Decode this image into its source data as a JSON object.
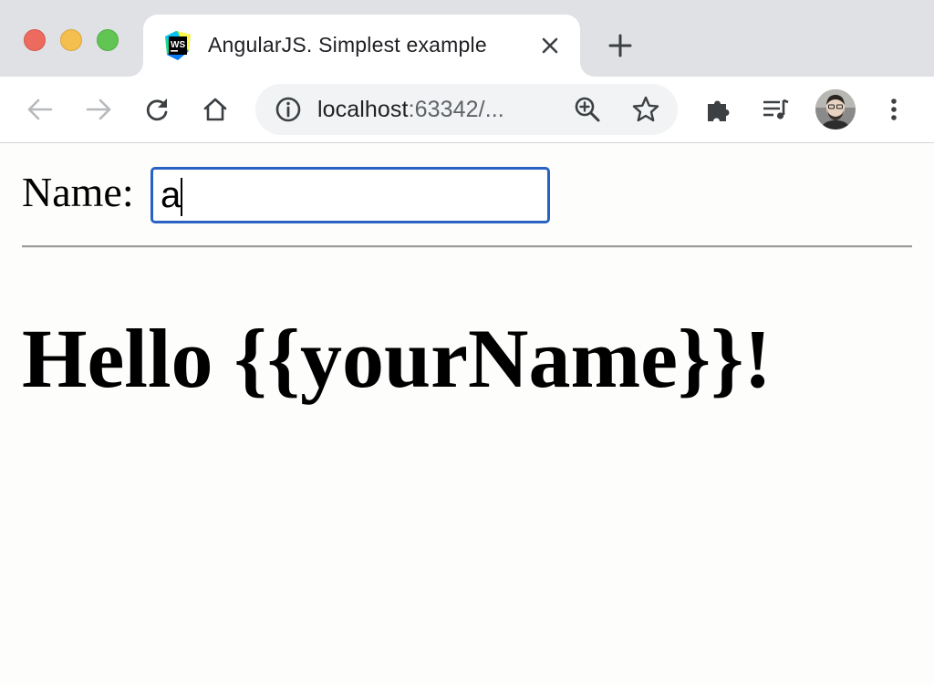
{
  "window": {
    "traffic_lights": {
      "close": "#ed6a5e",
      "minimize": "#f5bf4f",
      "maximize": "#61c554"
    }
  },
  "tab": {
    "title": "AngularJS. Simplest example",
    "favicon_label": "WS",
    "favicon_icon": "webstorm-icon"
  },
  "toolbar": {
    "url_host": "localhost",
    "url_rest": ":63342/...",
    "icons": [
      "back-icon",
      "forward-icon",
      "reload-icon",
      "home-icon",
      "site-info-icon",
      "zoom-icon",
      "bookmark-star-icon",
      "extensions-icon",
      "media-queue-icon",
      "avatar",
      "menu-icon"
    ]
  },
  "page": {
    "name_label": "Name:",
    "name_value": "a",
    "greeting": "Hello {{yourName}}!"
  },
  "colors": {
    "tabstrip": "#dfe1e5",
    "input_focus": "#2a62c4",
    "page_bg": "#fdfdfc"
  }
}
